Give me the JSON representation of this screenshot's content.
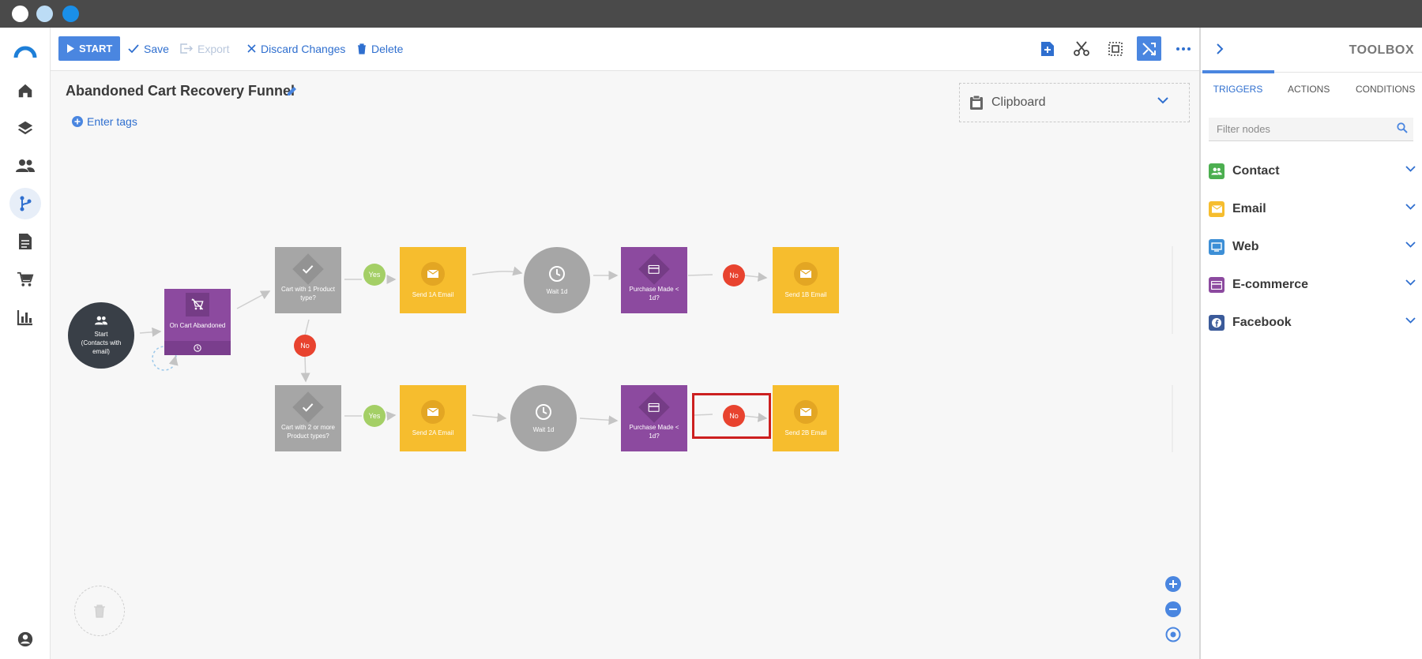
{
  "toolbar": {
    "start_label": "START",
    "save_label": "Save",
    "export_label": "Export",
    "discard_label": "Discard Changes",
    "delete_label": "Delete"
  },
  "flow": {
    "title": "Abandoned Cart Recovery Funnel",
    "tags_label": "Enter tags"
  },
  "clipboard": {
    "label": "Clipboard"
  },
  "nodes": {
    "start": "Start (Contacts with email)",
    "cart_abandoned": "On Cart Abandoned",
    "cond1": "Cart with 1 Product type?",
    "cond2": "Cart with 2 or more Product types?",
    "email_1a": "Send 1A Email",
    "email_2a": "Send 2A Email",
    "wait1": "Wait 1d",
    "wait2": "Wait 1d",
    "purchase1": "Purchase Made < 1d?",
    "purchase2": "Purchase Made < 1d?",
    "email_1b": "Send 1B Email",
    "email_2b": "Send 2B Email"
  },
  "branch_labels": {
    "yes": "Yes",
    "no": "No"
  },
  "toolbox": {
    "title": "TOOLBOX",
    "tabs": [
      "TRIGGERS",
      "ACTIONS",
      "CONDITIONS"
    ],
    "filter_placeholder": "Filter nodes",
    "categories": [
      {
        "label": "Contact",
        "color": "#4caf50",
        "icon": "people-icon"
      },
      {
        "label": "Email",
        "color": "#f6bd2e",
        "icon": "envelope-icon"
      },
      {
        "label": "Web",
        "color": "#3d8fd6",
        "icon": "monitor-icon"
      },
      {
        "label": "E-commerce",
        "color": "#8c4a9f",
        "icon": "card-icon"
      },
      {
        "label": "Facebook",
        "color": "#3b5b9a",
        "icon": "facebook-icon"
      }
    ]
  },
  "colors": {
    "accent": "#4a86e0",
    "condition": "#a6a6a6",
    "email": "#f6bd2e",
    "purchase": "#8c4a9f",
    "no": "#e8432f",
    "yes": "#a4cf66"
  }
}
